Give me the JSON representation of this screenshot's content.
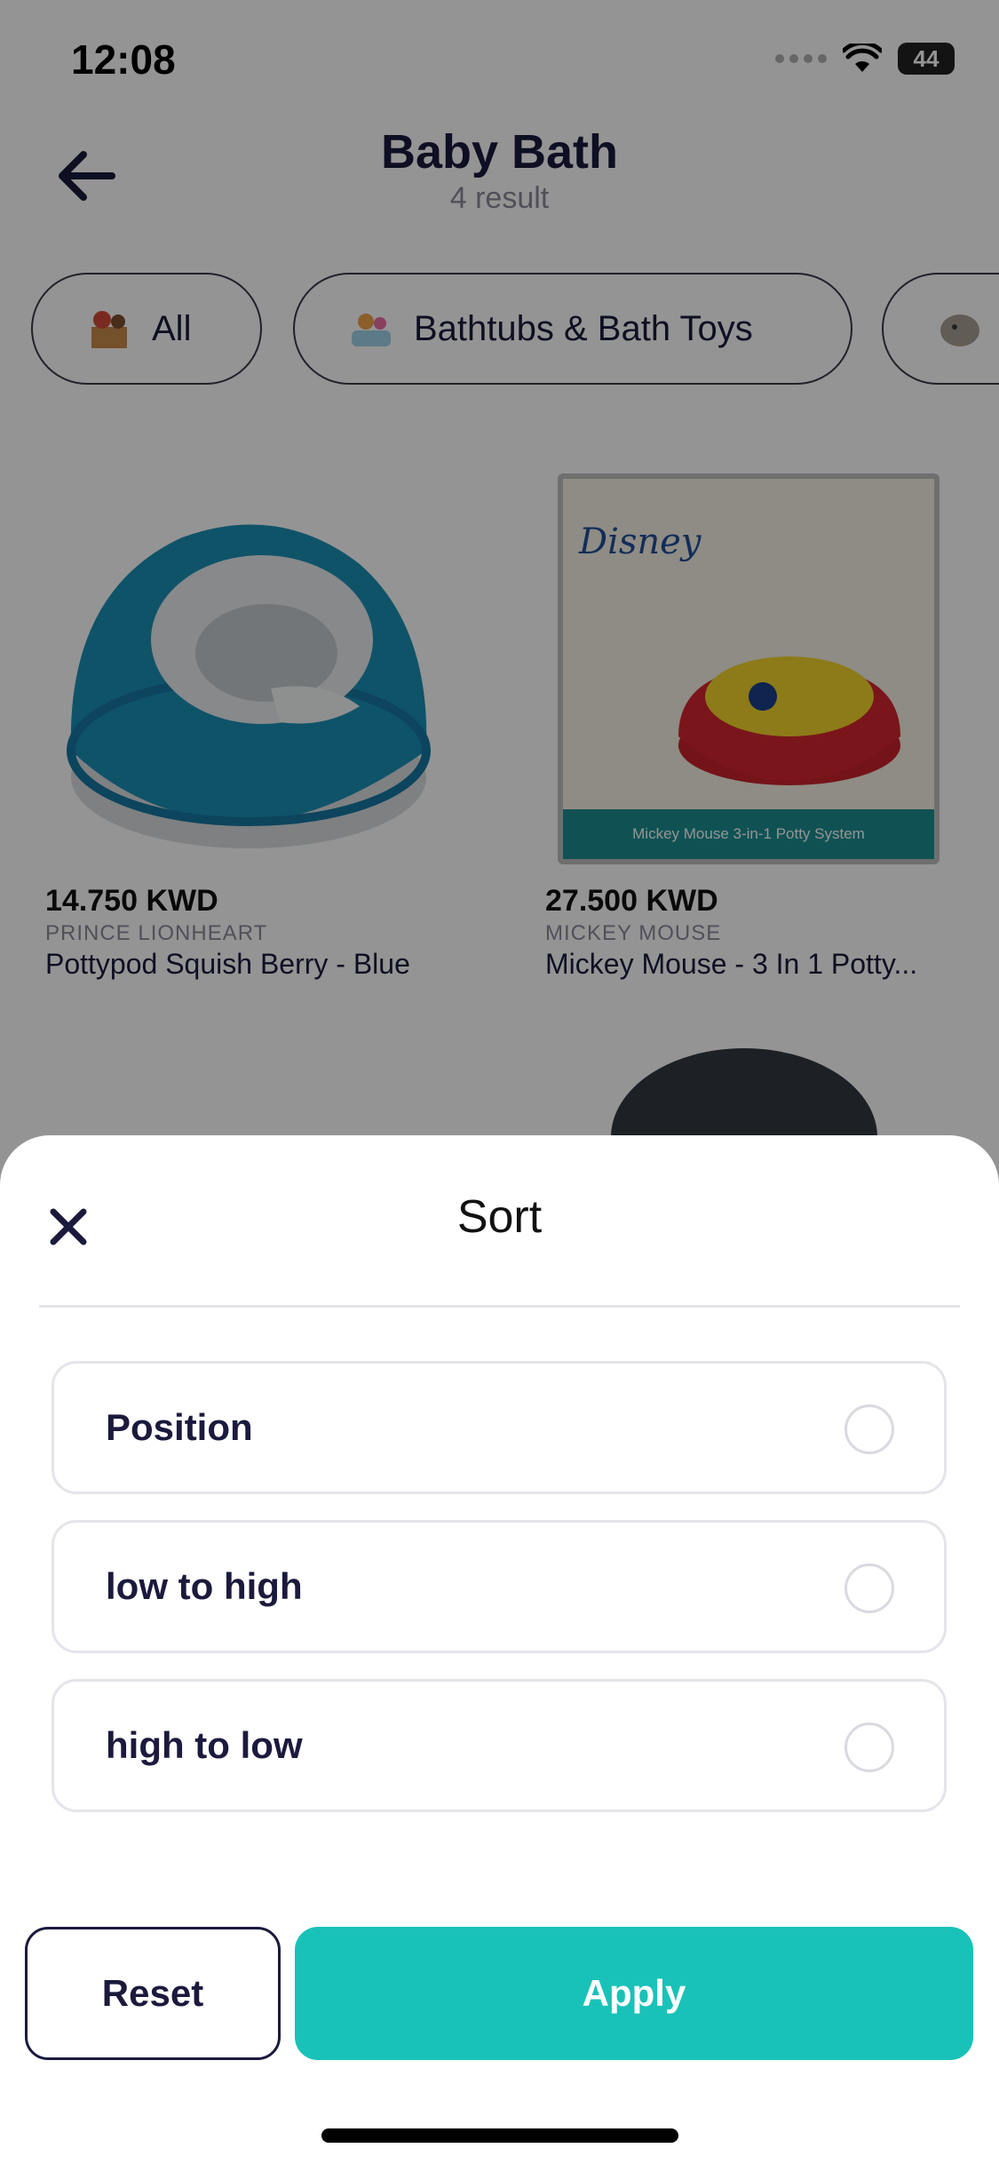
{
  "status_bar": {
    "time": "12:08",
    "battery": "44"
  },
  "header": {
    "title": "Baby Bath",
    "subtitle": "4 result"
  },
  "categories": [
    {
      "label": "All"
    },
    {
      "label": "Bathtubs & Bath Toys"
    },
    {
      "label": ""
    }
  ],
  "products": [
    {
      "price": "14.750 KWD",
      "brand": "PRINCE LIONHEART",
      "name": "Pottypod Squish Berry - Blue"
    },
    {
      "price": "27.500 KWD",
      "brand": "MICKEY MOUSE",
      "name": "Mickey Mouse - 3 In 1 Potty...",
      "box_caption": "Mickey Mouse 3-in-1 Potty System",
      "box_brand": "Disney"
    }
  ],
  "sort_sheet": {
    "title": "Sort",
    "options": [
      {
        "label": "Position",
        "selected": false
      },
      {
        "label": "low to high",
        "selected": false
      },
      {
        "label": "high to low",
        "selected": false
      }
    ],
    "reset_label": "Reset",
    "apply_label": "Apply"
  },
  "colors": {
    "accent": "#19c2b8",
    "text_dark": "#1b1a3d",
    "overlay": "rgba(0,0,0,0.42)"
  }
}
